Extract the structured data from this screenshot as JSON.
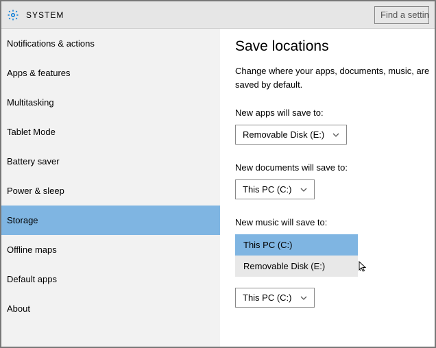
{
  "header": {
    "title": "SYSTEM",
    "search_placeholder": "Find a settin"
  },
  "sidebar": {
    "items": [
      "Notifications & actions",
      "Apps & features",
      "Multitasking",
      "Tablet Mode",
      "Battery saver",
      "Power & sleep",
      "Storage",
      "Offline maps",
      "Default apps",
      "About"
    ],
    "selected_index": 6
  },
  "content": {
    "title": "Save locations",
    "description": "Change where your apps, documents, music, are saved by default.",
    "fields": [
      {
        "label": "New apps will save to:",
        "value": "Removable Disk (E:)"
      },
      {
        "label": "New documents will save to:",
        "value": "This PC (C:)"
      }
    ],
    "music_label": "New music will save to:",
    "music_options": [
      "This PC (C:)",
      "Removable Disk (E:)"
    ],
    "music_selected_option_index": 0,
    "bottom_value": "This PC (C:)",
    "trailing": ":"
  }
}
